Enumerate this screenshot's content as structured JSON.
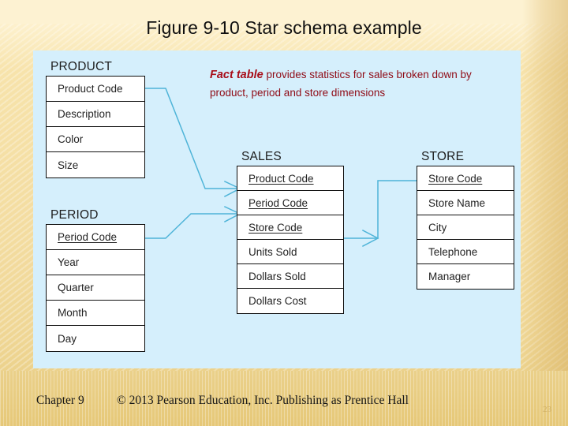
{
  "slide": {
    "title": "Figure 9-10 Star schema example",
    "page_number": "23"
  },
  "callout": {
    "lead": "Fact table",
    "rest": " provides statistics for sales broken down by product, period and store dimensions"
  },
  "entities": {
    "product": {
      "name": "PRODUCT",
      "rows": [
        {
          "label": "Product Code",
          "key": false
        },
        {
          "label": "Description",
          "key": false
        },
        {
          "label": "Color",
          "key": false
        },
        {
          "label": "Size",
          "key": false
        }
      ]
    },
    "period": {
      "name": "PERIOD",
      "rows": [
        {
          "label": "Period Code",
          "key": true
        },
        {
          "label": "Year",
          "key": false
        },
        {
          "label": "Quarter",
          "key": false
        },
        {
          "label": "Month",
          "key": false
        },
        {
          "label": "Day",
          "key": false
        }
      ]
    },
    "sales": {
      "name": "SALES",
      "rows": [
        {
          "label": "Product Code",
          "key": true
        },
        {
          "label": "Period Code",
          "key": true
        },
        {
          "label": "Store Code",
          "key": true
        },
        {
          "label": "Units Sold",
          "key": false
        },
        {
          "label": "Dollars Sold",
          "key": false
        },
        {
          "label": "Dollars Cost",
          "key": false
        }
      ]
    },
    "store": {
      "name": "STORE",
      "rows": [
        {
          "label": "Store Code",
          "key": true
        },
        {
          "label": "Store Name",
          "key": false
        },
        {
          "label": "City",
          "key": false
        },
        {
          "label": "Telephone",
          "key": false
        },
        {
          "label": "Manager",
          "key": false
        }
      ]
    }
  },
  "footer": {
    "chapter": "Chapter 9",
    "copyright": "© 2013 Pearson Education, Inc.  Publishing as Prentice Hall"
  },
  "colors": {
    "panel_blue": "#d5effc",
    "connector": "#4fb4d8",
    "callout_red": "#8f0b16",
    "background_cream": "#fdf1cf",
    "footer_band": "#e8cc80"
  }
}
